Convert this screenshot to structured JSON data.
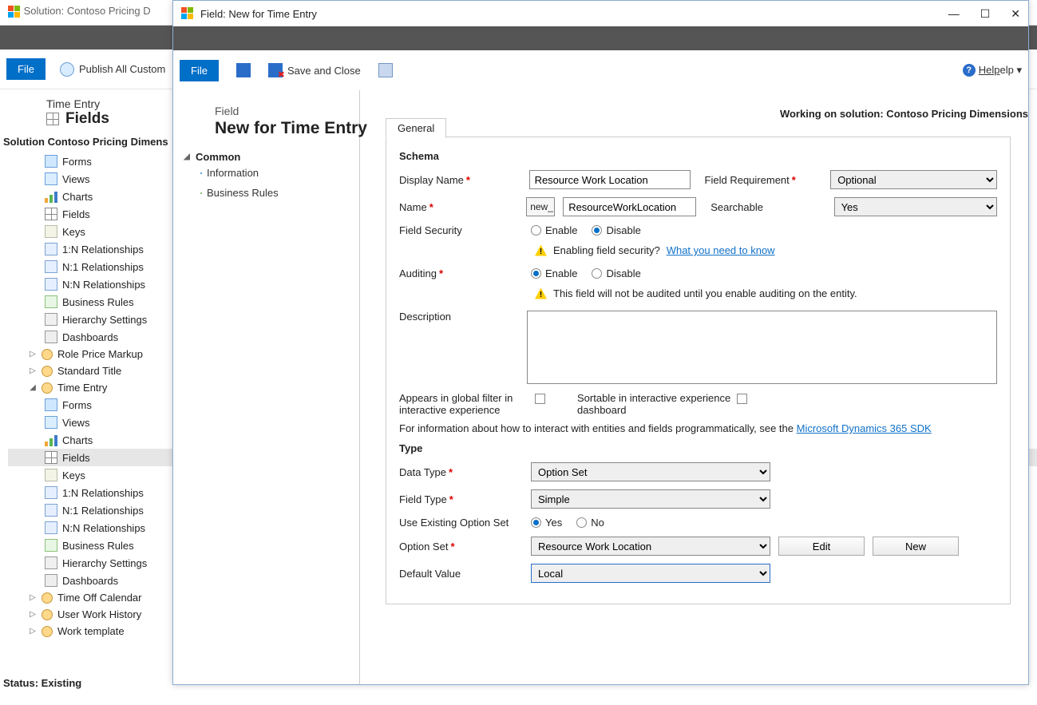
{
  "backWindow": {
    "title": "Solution: Contoso Pricing D",
    "dark_right": "9",
    "file_label": "File",
    "publish_label": "Publish All Custom",
    "entity_sub": "Time Entry",
    "entity_title": "Fields",
    "solution_header": "Solution Contoso Pricing Dimens",
    "status": "Status: Existing",
    "tree_top": [
      {
        "label": "Forms"
      },
      {
        "label": "Views"
      },
      {
        "label": "Charts"
      },
      {
        "label": "Fields"
      },
      {
        "label": "Keys"
      },
      {
        "label": "1:N Relationships"
      },
      {
        "label": "N:1 Relationships"
      },
      {
        "label": "N:N Relationships"
      },
      {
        "label": "Business Rules"
      },
      {
        "label": "Hierarchy Settings"
      },
      {
        "label": "Dashboards"
      }
    ],
    "entities": [
      {
        "label": "Role Price Markup",
        "expanded": false
      },
      {
        "label": "Standard Title",
        "expanded": false
      },
      {
        "label": "Time Entry",
        "expanded": true,
        "children": [
          {
            "label": "Forms"
          },
          {
            "label": "Views"
          },
          {
            "label": "Charts"
          },
          {
            "label": "Fields",
            "selected": true
          },
          {
            "label": "Keys"
          },
          {
            "label": "1:N Relationships"
          },
          {
            "label": "N:1 Relationships"
          },
          {
            "label": "N:N Relationships"
          },
          {
            "label": "Business Rules"
          },
          {
            "label": "Hierarchy Settings"
          },
          {
            "label": "Dashboards"
          }
        ]
      },
      {
        "label": "Time Off Calendar",
        "expanded": false
      },
      {
        "label": "User Work History",
        "expanded": false
      },
      {
        "label": "Work template",
        "expanded": false
      }
    ]
  },
  "frontWindow": {
    "title": "Field: New for Time Entry",
    "file_label": "File",
    "save_close_label": "Save and Close",
    "help_label": "Help",
    "page_small": "Field",
    "page_large": "New for Time Entry",
    "working_label": "Working on solution: Contoso Pricing Dimensions",
    "common_header": "Common",
    "common_items": [
      {
        "label": "Information"
      },
      {
        "label": "Business Rules"
      }
    ],
    "tab_label": "General",
    "schema_title": "Schema",
    "display_name_label": "Display Name",
    "display_name_value": "Resource Work Location",
    "field_req_label": "Field Requirement",
    "field_req_value": "Optional",
    "name_label": "Name",
    "name_prefix": "new_",
    "name_value": "ResourceWorkLocation",
    "searchable_label": "Searchable",
    "searchable_value": "Yes",
    "field_security_label": "Field Security",
    "enable_label": "Enable",
    "disable_label": "Disable",
    "fs_warning": "Enabling field security?",
    "fs_link": "What you need to know",
    "auditing_label": "Auditing",
    "audit_warning": "This field will not be audited until you enable auditing on the entity.",
    "description_label": "Description",
    "global_filter_label": "Appears in global filter in interactive experience",
    "sortable_label": "Sortable in interactive experience dashboard",
    "sdk_text": "For information about how to interact with entities and fields programmatically, see the",
    "sdk_link": "Microsoft Dynamics 365 SDK",
    "type_title": "Type",
    "data_type_label": "Data Type",
    "data_type_value": "Option Set",
    "field_type_label": "Field Type",
    "field_type_value": "Simple",
    "use_existing_label": "Use Existing Option Set",
    "yes_label": "Yes",
    "no_label": "No",
    "option_set_label": "Option Set",
    "option_set_value": "Resource Work Location",
    "edit_label": "Edit",
    "new_label": "New",
    "default_value_label": "Default Value",
    "default_value_value": "Local"
  }
}
